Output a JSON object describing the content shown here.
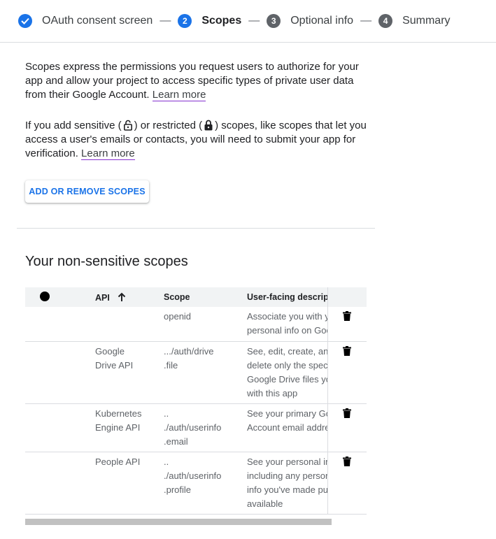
{
  "stepper": {
    "steps": [
      {
        "label": "OAuth consent screen",
        "number": "",
        "state": "done"
      },
      {
        "label": "Scopes",
        "number": "2",
        "state": "active"
      },
      {
        "label": "Optional info",
        "number": "3",
        "state": "todo"
      },
      {
        "label": "Summary",
        "number": "4",
        "state": "todo"
      }
    ],
    "separator": "—"
  },
  "intro": {
    "para1_lines": [
      "Scopes express the permissions you request users to authorize for your",
      "app and allow your project to access specific types of private user data",
      "from their Google Account."
    ],
    "para2_line1_a": "If you add sensitive (",
    "para2_line1_b": ") or restricted (",
    "para2_line1_c": ") scopes, like scopes that let you",
    "para2_line2": "access a user's emails or contacts, you will need to submit your app for",
    "para2_line3": "verification.",
    "learn_more": "Learn more"
  },
  "add_remove_button": "ADD OR REMOVE SCOPES",
  "section_title": "Your non-sensitive scopes",
  "table": {
    "columns": {
      "api": "API",
      "scope": "Scope",
      "description": "User-facing descriptio"
    },
    "rows": [
      {
        "api": [],
        "scope": [
          "openid"
        ],
        "description": [
          "Associate you with y",
          "personal info on Goo"
        ]
      },
      {
        "api": [
          "Google",
          "Drive API"
        ],
        "scope": [
          ".../auth/drive",
          ".file"
        ],
        "description": [
          "See, edit, create, and",
          "delete only the spec",
          "Google Drive files yo",
          "with this app"
        ]
      },
      {
        "api": [
          "Kubernetes",
          "Engine API"
        ],
        "scope": [
          "..",
          "./auth/userinfo",
          ".email"
        ],
        "description": [
          "See your primary Go",
          "Account email addre"
        ]
      },
      {
        "api": [
          "People API"
        ],
        "scope": [
          "..",
          "./auth/userinfo",
          ".profile"
        ],
        "description": [
          "See your personal in",
          "including any persor",
          "info you've made pu",
          "available"
        ]
      }
    ]
  },
  "colors": {
    "accent": "#1a73e8",
    "link_underline": "#8430ce",
    "divider": "#dadce0"
  }
}
